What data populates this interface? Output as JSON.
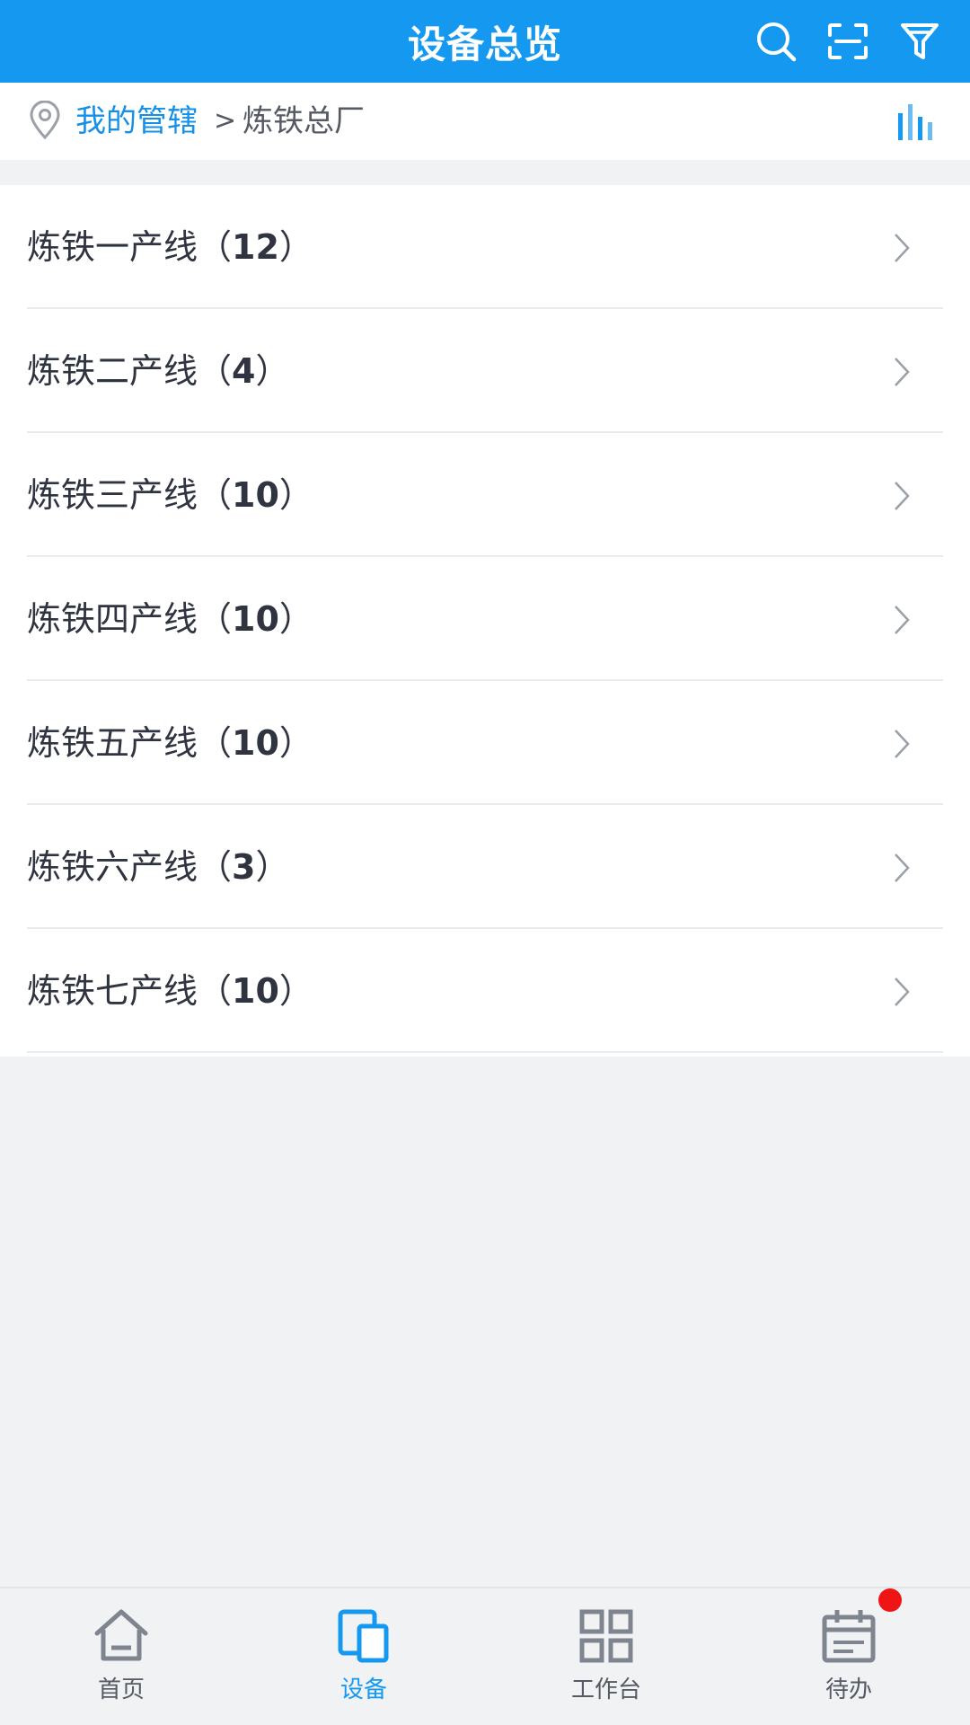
{
  "header": {
    "title": "设备总览",
    "actions": [
      "search-icon",
      "scan-icon",
      "filter-icon"
    ]
  },
  "breadcrumb": {
    "root": "我的管辖",
    "separator": ">",
    "current": "炼铁总厂"
  },
  "lines": [
    {
      "name": "炼铁一产线",
      "count": "12"
    },
    {
      "name": "炼铁二产线",
      "count": "4"
    },
    {
      "name": "炼铁三产线",
      "count": "10"
    },
    {
      "name": "炼铁四产线",
      "count": "10"
    },
    {
      "name": "炼铁五产线",
      "count": "10"
    },
    {
      "name": "炼铁六产线",
      "count": "3"
    },
    {
      "name": "炼铁七产线",
      "count": "10"
    }
  ],
  "tabs": [
    {
      "label": "首页",
      "icon": "home-icon",
      "active": false
    },
    {
      "label": "设备",
      "icon": "device-icon",
      "active": true
    },
    {
      "label": "工作台",
      "icon": "grid-icon",
      "active": false
    },
    {
      "label": "待办",
      "icon": "calendar-icon",
      "active": false,
      "badge": true
    }
  ],
  "colors": {
    "accent": "#1599f0",
    "badge": "#f01515",
    "background": "#f1f2f4"
  }
}
